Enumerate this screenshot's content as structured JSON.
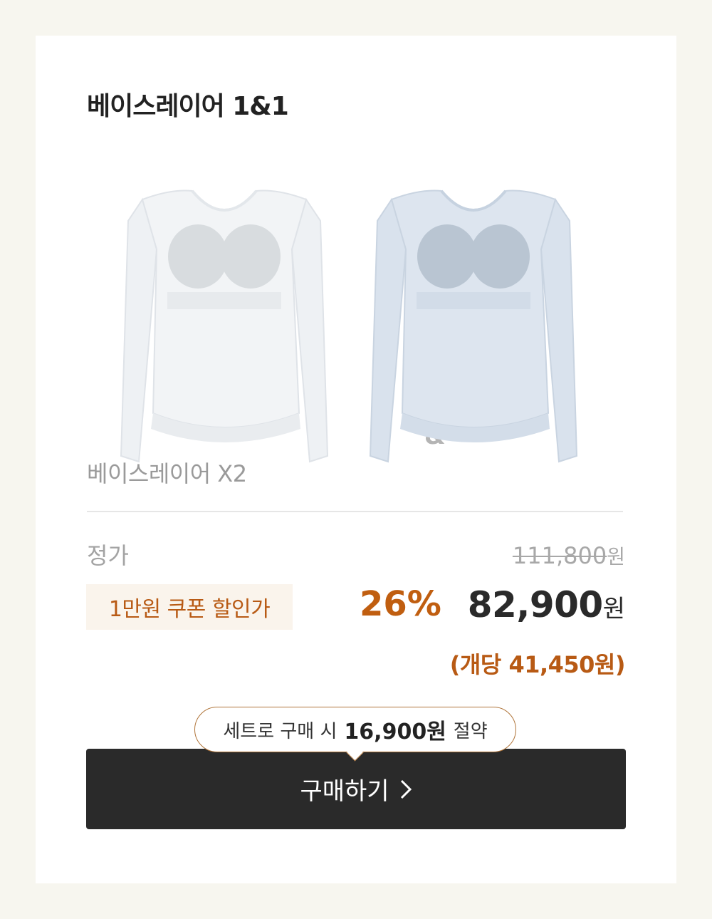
{
  "product": {
    "title": "베이스레이어 1&1",
    "separator": "&",
    "subtitle": "베이스레이어 X2",
    "images": [
      {
        "icon": "white-baselayer-top-image",
        "color": "#f1f3f5"
      },
      {
        "icon": "blue-baselayer-top-image",
        "color": "#dbe4ef"
      }
    ]
  },
  "pricing": {
    "regular_label": "정가",
    "regular_price": "111,800",
    "regular_unit": "원",
    "coupon_label": "1만원 쿠폰 할인가",
    "discount_rate": "26%",
    "sale_price": "82,900",
    "sale_unit": "원",
    "per_item": "(개당 41,450원)"
  },
  "promo": {
    "prefix": "세트로 구매 시",
    "amount": "16,900원",
    "suffix": "절약"
  },
  "cta": {
    "label": "구매하기",
    "icon": "chevron-right-icon"
  },
  "colors": {
    "accent": "#c05e10",
    "button": "#2a2a2a",
    "page_bg": "#f7f6ef"
  }
}
